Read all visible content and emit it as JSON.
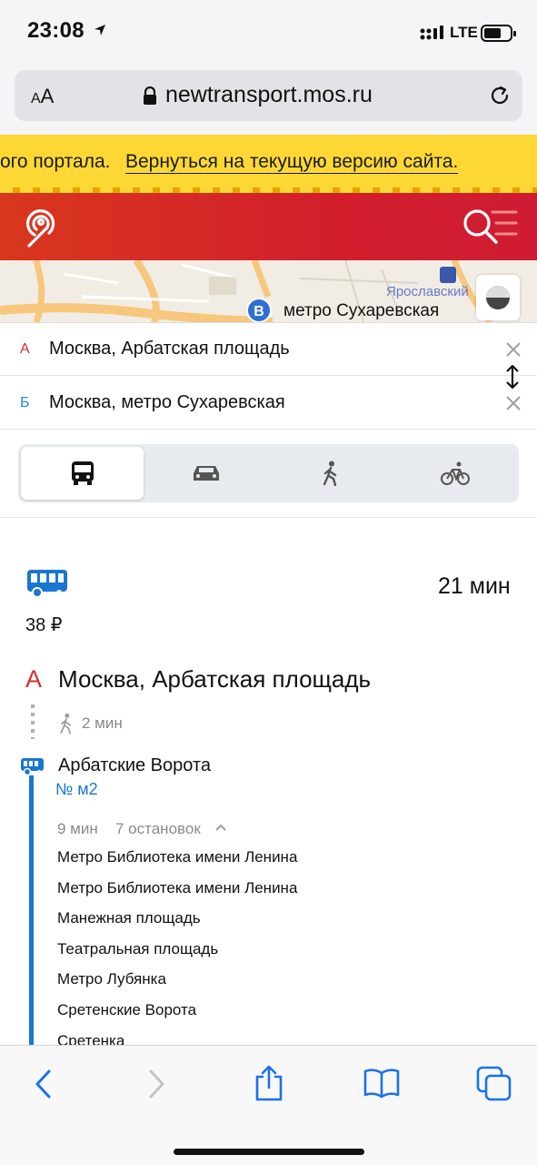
{
  "status_bar": {
    "time": "23:08",
    "network": "LTE"
  },
  "browser": {
    "text_size_label": "AA",
    "url": "newtransport.mos.ru"
  },
  "banner": {
    "text": "ого портала.",
    "link": "Вернуться на текущую версию сайта."
  },
  "map": {
    "pin_letter": "B",
    "place_label": "метро Сухаревская",
    "street_label": "Ярославский"
  },
  "route": {
    "from": {
      "letter": "А",
      "value": "Москва, Арбатская площадь"
    },
    "to": {
      "letter": "Б",
      "value": "Москва, метро Сухаревская"
    }
  },
  "modes": [
    "bus-icon",
    "car-icon",
    "walk-icon",
    "bicycle-icon"
  ],
  "result": {
    "price": "38 ₽",
    "duration": "21 мин",
    "start_letter": "А",
    "start_name": "Москва, Арбатская площадь",
    "walk_time": "2 мин",
    "segment": {
      "stop": "Арбатские Ворота",
      "route": "№ м2",
      "time": "9 мин",
      "stops_count": "7 остановок",
      "stops": [
        "Метро Библиотека имени Ленина",
        "Метро Библиотека имени Ленина",
        "Манежная площадь",
        "Театральная площадь",
        "Метро Лубянка",
        "Сретенские Ворота",
        "Сретенка"
      ]
    }
  },
  "colors": {
    "brand_red": "#d21f2c",
    "banner_yellow": "#fdd835",
    "transit_blue": "#1976d2"
  }
}
